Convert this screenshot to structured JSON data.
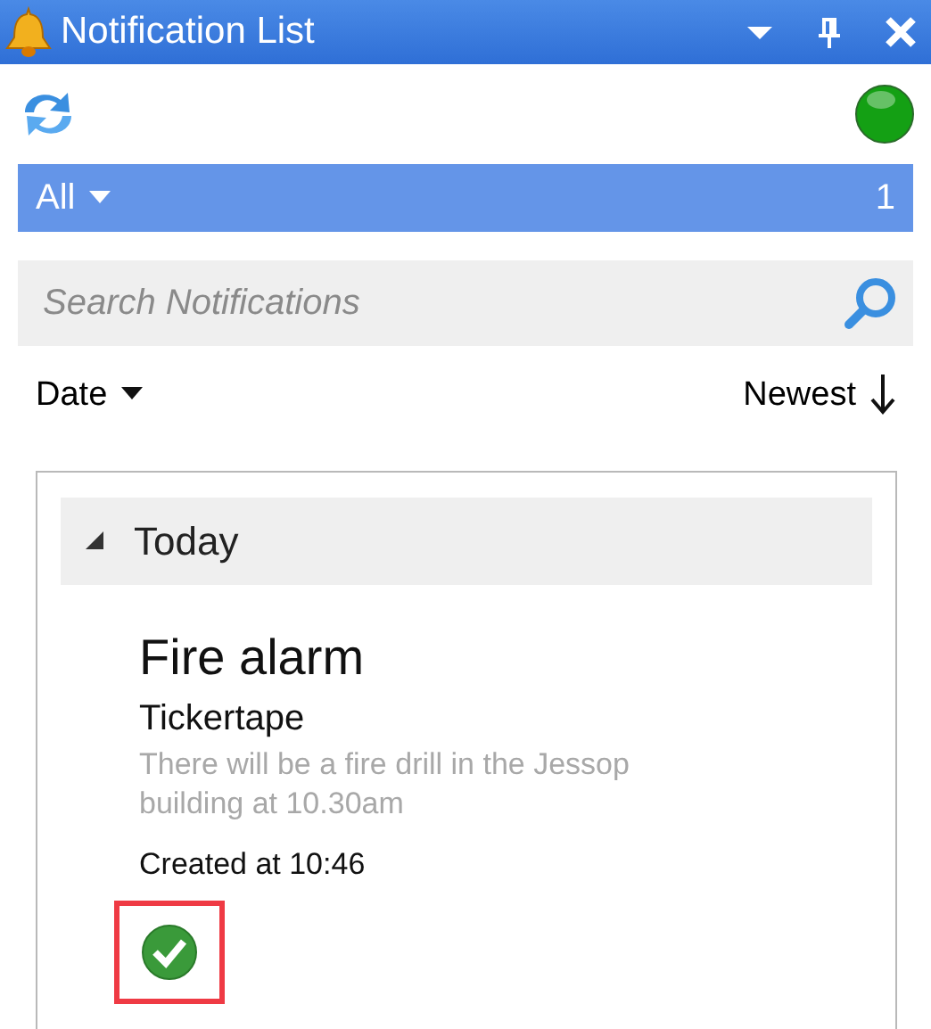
{
  "window": {
    "title": "Notification List"
  },
  "status": {
    "connected": true
  },
  "filter": {
    "label": "All",
    "count": "1"
  },
  "search": {
    "placeholder": "Search Notifications"
  },
  "sort": {
    "field": "Date",
    "order": "Newest"
  },
  "groups": [
    {
      "label": "Today",
      "expanded": true,
      "items": [
        {
          "title": "Fire alarm",
          "channel": "Tickertape",
          "message": "There will be a fire drill in the Jessop building at 10.30am",
          "created": "Created at 10:46",
          "acknowledged": true,
          "highlighted": true
        }
      ]
    }
  ]
}
